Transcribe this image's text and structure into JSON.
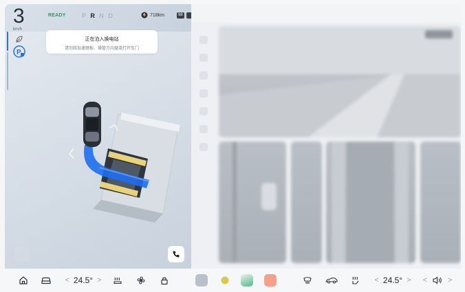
{
  "status": {
    "speed": "3",
    "speed_unit": "km/h",
    "ready": "READY",
    "gears": [
      "P",
      "R",
      "N",
      "D"
    ],
    "active_gear": "R",
    "range": "718km",
    "battery_badge": "98"
  },
  "notice": {
    "title": "正在泊入换电站",
    "subtitle": "请勿踩加速踏板、操管方向盘或打开车门"
  },
  "climate": {
    "left_temp": "24.5°",
    "right_temp": "24.5°"
  },
  "bottom_icons": {
    "left": [
      "home-icon",
      "car-icon",
      "seat-heat-icon",
      "fan-icon",
      "lock-icon"
    ],
    "apps": [
      "360-camera-icon",
      "nio-app-icon",
      "photo-app-icon",
      "game-app-icon"
    ],
    "right": [
      "defrost-icon",
      "car-profile-icon",
      "seat-heat-right-icon",
      "volume-icon"
    ]
  },
  "colors": {
    "ready": "#1aa54e",
    "path": "#1e6ef0",
    "platform_stripe": "#e8d27a",
    "accent": "#2b6ed9"
  }
}
